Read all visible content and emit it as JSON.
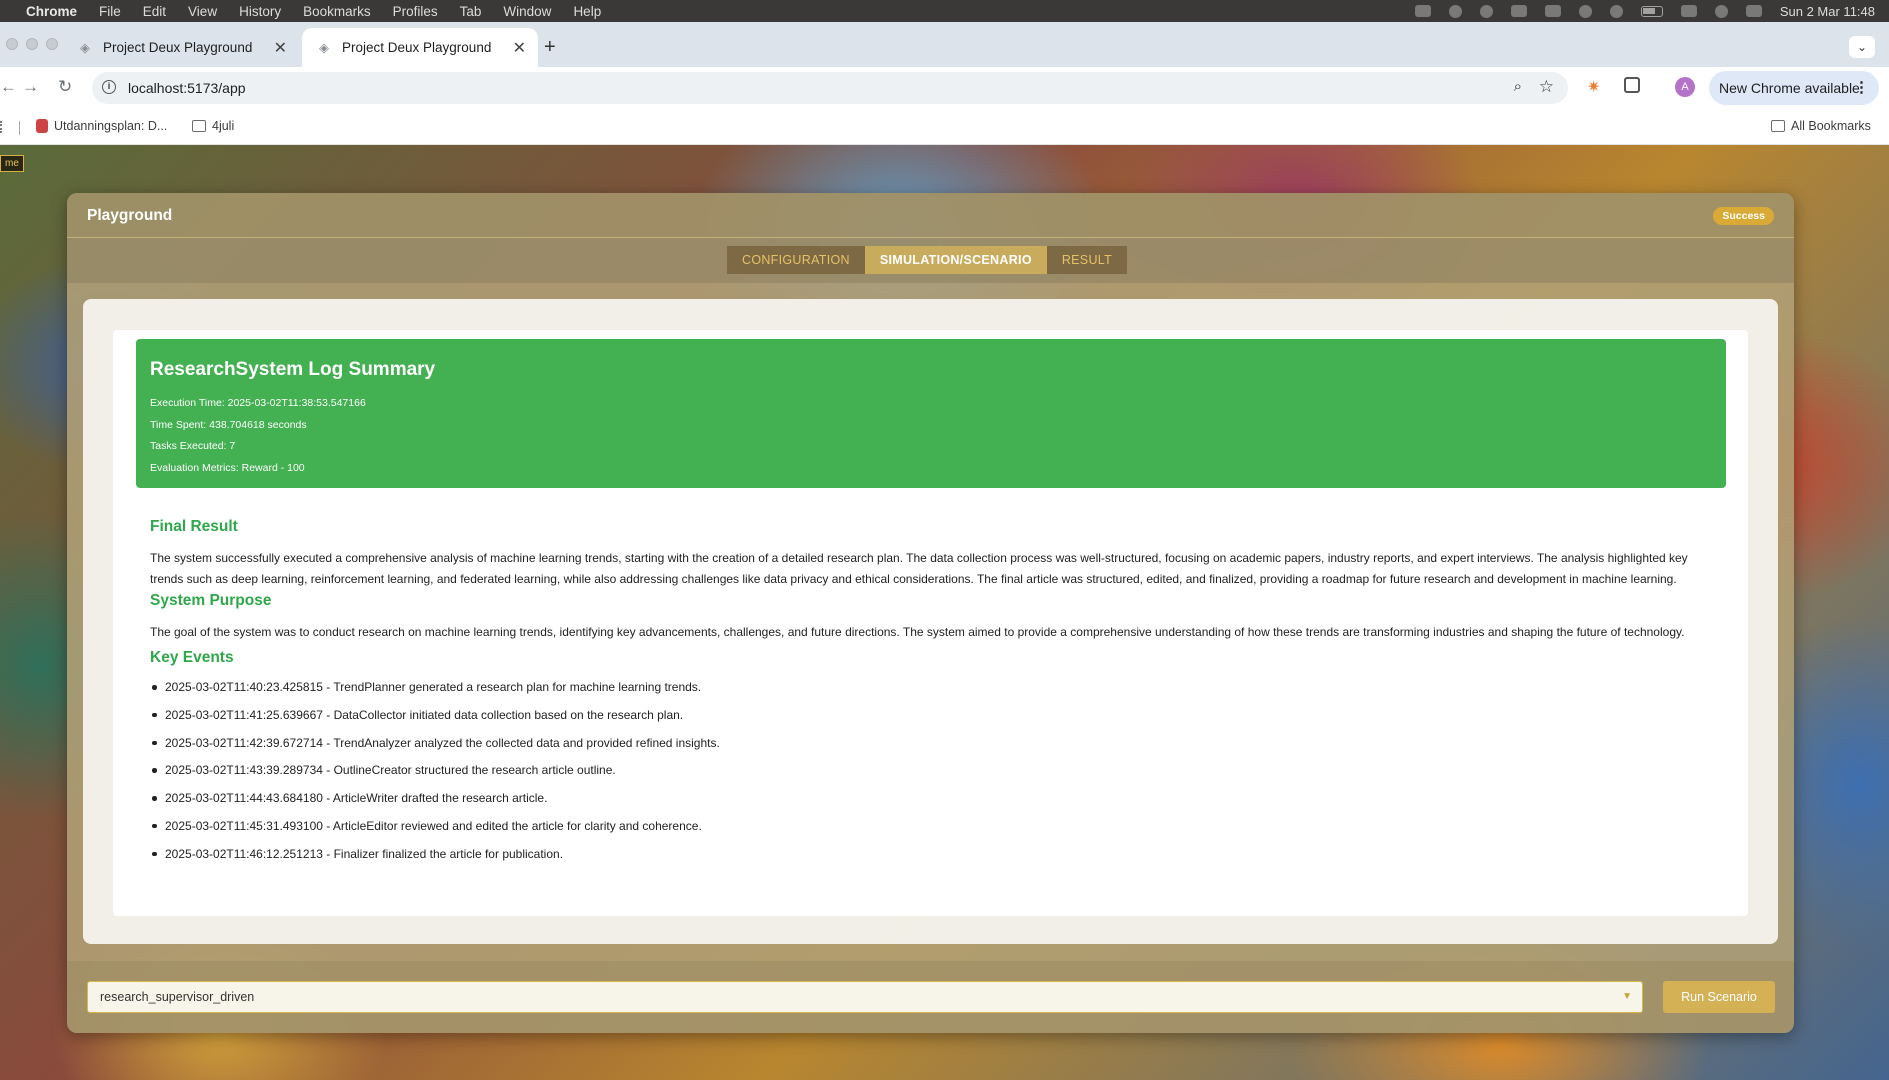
{
  "menubar": {
    "app": "Chrome",
    "items": [
      "File",
      "Edit",
      "View",
      "History",
      "Bookmarks",
      "Profiles",
      "Tab",
      "Window",
      "Help"
    ],
    "clock": "Sun 2 Mar  11:48"
  },
  "browser": {
    "tabs": [
      {
        "title": "Project Deux Playground"
      },
      {
        "title": "Project Deux Playground"
      }
    ],
    "url": "localhost:5173/app",
    "update_label": "New Chrome available",
    "avatar_letter": "A",
    "bookmarks": [
      {
        "label": "Utdanningsplan: D..."
      },
      {
        "label": "4juli"
      }
    ],
    "all_bookmarks": "All Bookmarks"
  },
  "page": {
    "corner_tag": "me",
    "panel_title": "Playground",
    "status_badge": "Success",
    "tabs": [
      {
        "label": "CONFIGURATION"
      },
      {
        "label": "SIMULATION/SCENARIO"
      },
      {
        "label": "RESULT"
      }
    ],
    "summary": {
      "title": "ResearchSystem Log Summary",
      "execution_time": "Execution Time: 2025-03-02T11:38:53.547166",
      "time_spent": "Time Spent: 438.704618 seconds",
      "tasks_executed": "Tasks Executed: 7",
      "evaluation": "Evaluation Metrics: Reward - 100"
    },
    "final_result": {
      "heading": "Final Result",
      "text": "The system successfully executed a comprehensive analysis of machine learning trends, starting with the creation of a detailed research plan. The data collection process was well-structured, focusing on academic papers, industry reports, and expert interviews. The analysis highlighted key trends such as deep learning, reinforcement learning, and federated learning, while also addressing challenges like data privacy and ethical considerations. The final article was structured, edited, and finalized, providing a roadmap for future research and development in machine learning."
    },
    "system_purpose": {
      "heading": "System Purpose",
      "text": "The goal of the system was to conduct research on machine learning trends, identifying key advancements, challenges, and future directions. The system aimed to provide a comprehensive understanding of how these trends are transforming industries and shaping the future of technology."
    },
    "key_events": {
      "heading": "Key Events",
      "items": [
        "2025-03-02T11:40:23.425815 - TrendPlanner generated a research plan for machine learning trends.",
        "2025-03-02T11:41:25.639667 - DataCollector initiated data collection based on the research plan.",
        "2025-03-02T11:42:39.672714 - TrendAnalyzer analyzed the collected data and provided refined insights.",
        "2025-03-02T11:43:39.289734 - OutlineCreator structured the research article outline.",
        "2025-03-02T11:44:43.684180 - ArticleWriter drafted the research article.",
        "2025-03-02T11:45:31.493100 - ArticleEditor reviewed and edited the article for clarity and coherence.",
        "2025-03-02T11:46:12.251213 - Finalizer finalized the article for publication."
      ]
    },
    "scenario_select": {
      "value": "research_supervisor_driven"
    },
    "run_button": "Run Scenario"
  },
  "colors": {
    "summary_green": "#43b052",
    "heading_green": "#2fa74a",
    "accent_gold": "#d4b155",
    "tab_inactive_text": "#e6c266"
  },
  "icons": [
    "apple-icon",
    "favicon-icon",
    "close-icon",
    "plus-icon",
    "back-icon",
    "forward-icon",
    "reload-icon",
    "info-icon",
    "zoom-icon",
    "star-icon",
    "extension-icon",
    "puzzle-icon",
    "kebab-menu-icon",
    "folder-icon",
    "chevron-down-icon"
  ]
}
